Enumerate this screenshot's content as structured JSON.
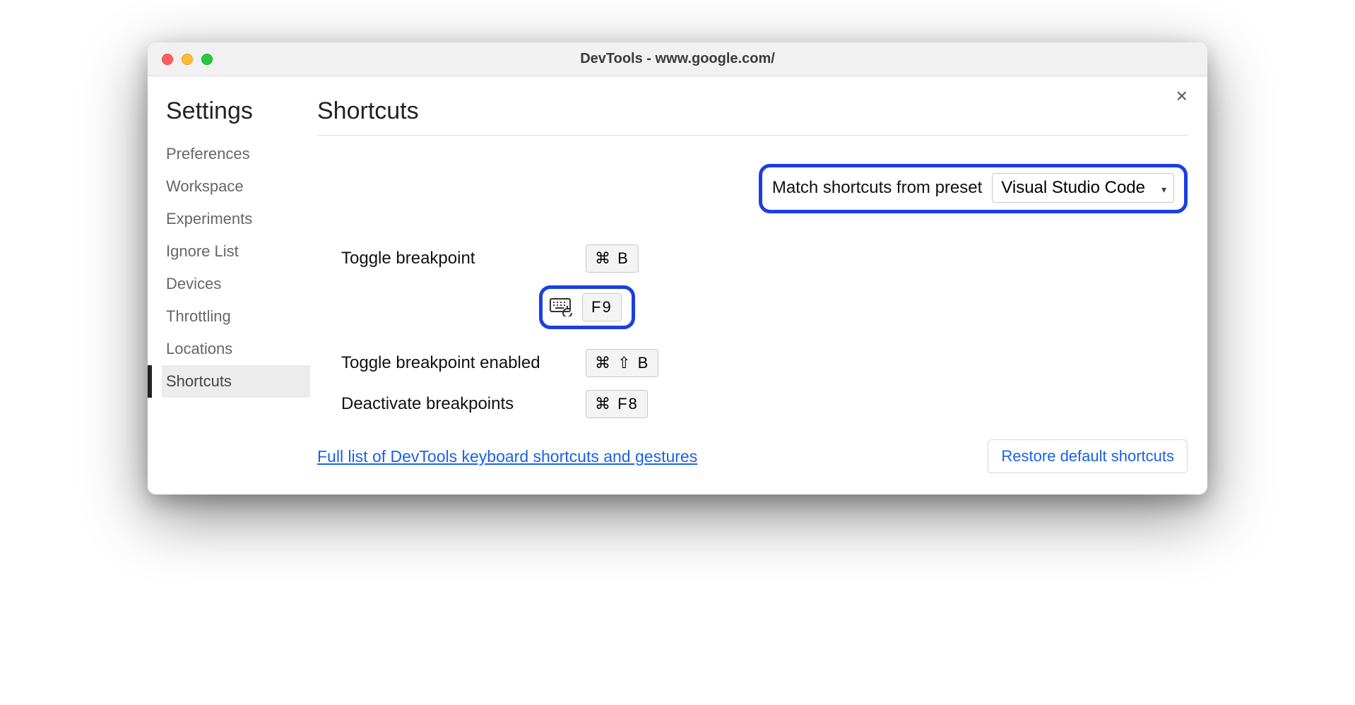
{
  "window": {
    "title": "DevTools - www.google.com/"
  },
  "sidebar": {
    "title": "Settings",
    "items": [
      {
        "label": "Preferences",
        "active": false
      },
      {
        "label": "Workspace",
        "active": false
      },
      {
        "label": "Experiments",
        "active": false
      },
      {
        "label": "Ignore List",
        "active": false
      },
      {
        "label": "Devices",
        "active": false
      },
      {
        "label": "Throttling",
        "active": false
      },
      {
        "label": "Locations",
        "active": false
      },
      {
        "label": "Shortcuts",
        "active": true
      }
    ]
  },
  "main": {
    "heading": "Shortcuts",
    "preset_label": "Match shortcuts from preset",
    "preset_value": "Visual Studio Code",
    "shortcuts": [
      {
        "label": "Toggle breakpoint",
        "keys": "⌘ B"
      },
      {
        "extra_key": "F9"
      },
      {
        "label": "Toggle breakpoint enabled",
        "keys": "⌘ ⇧ B"
      },
      {
        "label": "Deactivate breakpoints",
        "keys": "⌘ F8"
      }
    ],
    "link_text": "Full list of DevTools keyboard shortcuts and gestures",
    "restore_button": "Restore default shortcuts"
  }
}
